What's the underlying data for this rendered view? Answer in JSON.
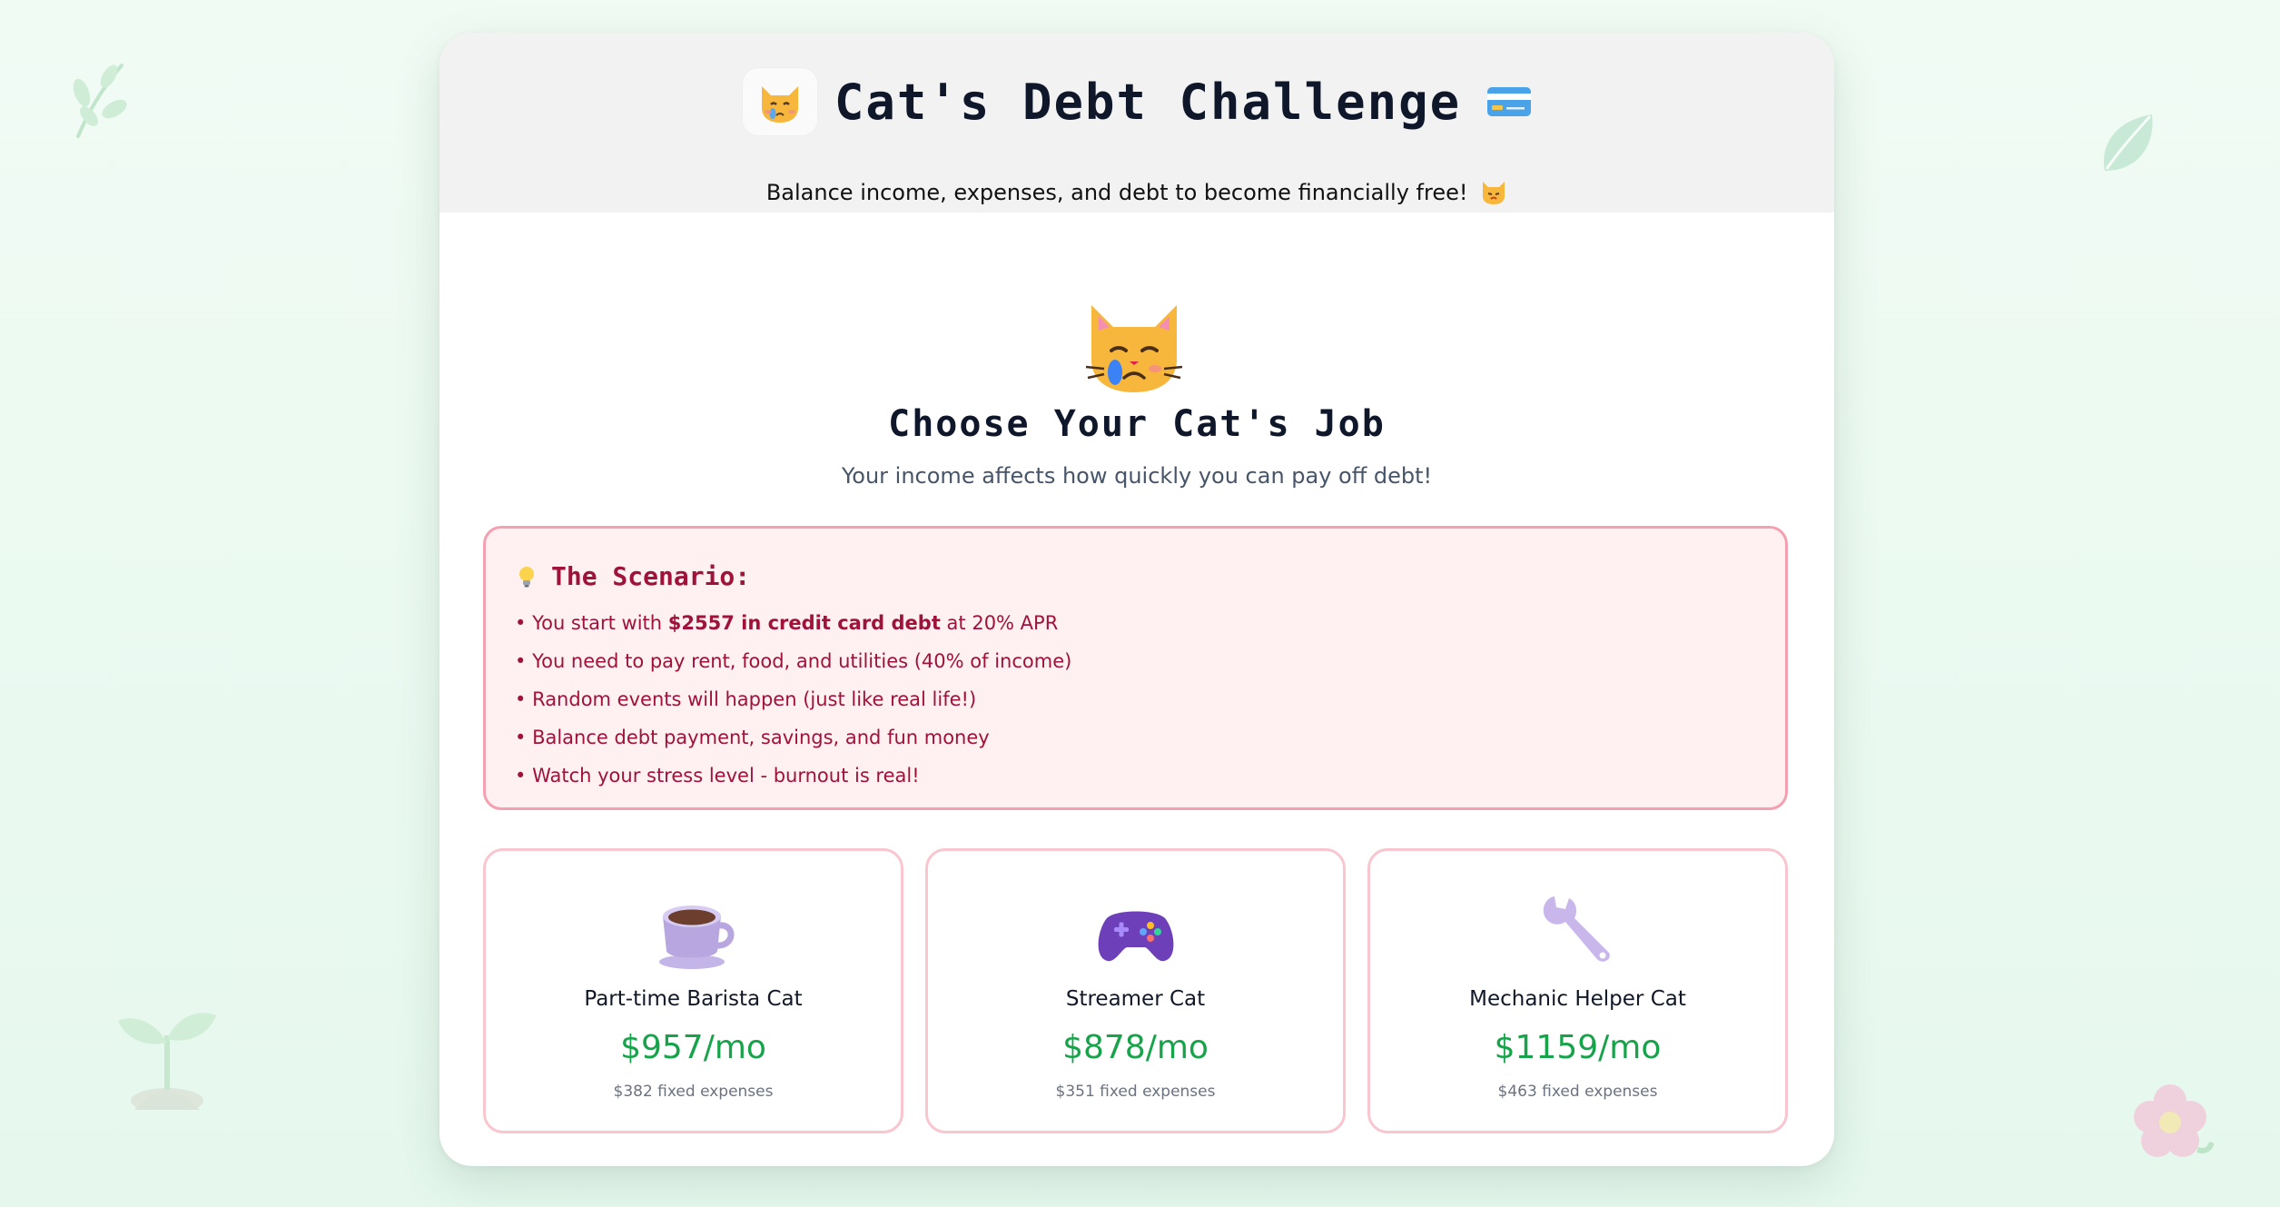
{
  "header": {
    "title": "Cat's Debt Challenge",
    "subtitle": "Balance income, expenses, and debt to become financially free!",
    "title_icon": "crying-cat-icon",
    "title_trailing_icon": "credit-card-icon",
    "subtitle_icon": "cat-face-icon"
  },
  "intro": {
    "hero_icon": "crying-cat-icon",
    "heading": "Choose Your Cat's Job",
    "subheading": "Your income affects how quickly you can pay off debt!"
  },
  "scenario": {
    "icon": "lightbulb-icon",
    "title": "The Scenario:",
    "items": [
      {
        "before": "You start with ",
        "bold": "$2557 in credit card debt",
        "after": " at 20% APR"
      },
      {
        "before": "You need to pay rent, food, and utilities (40% of income)"
      },
      {
        "before": "Random events will happen (just like real life!)"
      },
      {
        "before": "Balance debt payment, savings, and fun money"
      },
      {
        "before": "Watch your stress level - burnout is real!"
      }
    ]
  },
  "jobs": [
    {
      "icon": "coffee-cup-icon",
      "name": "Part-time Barista Cat",
      "income": "$957/mo",
      "fixed": "$382 fixed expenses"
    },
    {
      "icon": "game-controller-icon",
      "name": "Streamer Cat",
      "income": "$878/mo",
      "fixed": "$351 fixed expenses"
    },
    {
      "icon": "wrench-icon",
      "name": "Mechanic Helper Cat",
      "income": "$1159/mo",
      "fixed": "$463 fixed expenses"
    }
  ],
  "colors": {
    "accent_green": "#16a34a",
    "scenario_text": "#9f1239",
    "scenario_border": "#f5a0b0",
    "job_border": "#f9c5cf"
  }
}
